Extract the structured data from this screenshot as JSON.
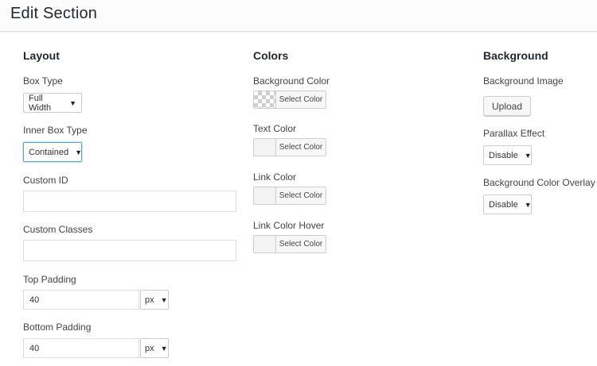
{
  "header": {
    "title": "Edit Section"
  },
  "layout": {
    "title": "Layout",
    "box_type": {
      "label": "Box Type",
      "value": "Full Width"
    },
    "inner_box_type": {
      "label": "Inner Box Type",
      "value": "Contained"
    },
    "custom_id": {
      "label": "Custom ID",
      "value": ""
    },
    "custom_classes": {
      "label": "Custom Classes",
      "value": ""
    },
    "top_padding": {
      "label": "Top Padding",
      "value": "40",
      "unit": "px"
    },
    "bottom_padding": {
      "label": "Bottom Padding",
      "value": "40",
      "unit": "px"
    }
  },
  "colors": {
    "title": "Colors",
    "select_label": "Select Color",
    "items": [
      {
        "label": "Background Color",
        "swatch": "transparent"
      },
      {
        "label": "Text Color",
        "swatch": "empty"
      },
      {
        "label": "Link Color",
        "swatch": "empty"
      },
      {
        "label": "Link Color Hover",
        "swatch": "empty"
      }
    ]
  },
  "background": {
    "title": "Background",
    "image": {
      "label": "Background Image",
      "button": "Upload"
    },
    "parallax": {
      "label": "Parallax Effect",
      "value": "Disable"
    },
    "overlay": {
      "label": "Background Color Overlay",
      "value": "Disable"
    }
  },
  "icons": {
    "caret": "caret-down-icon"
  },
  "theme": {
    "focus_border": "#5b9dd9",
    "title_color": "#23282d"
  }
}
